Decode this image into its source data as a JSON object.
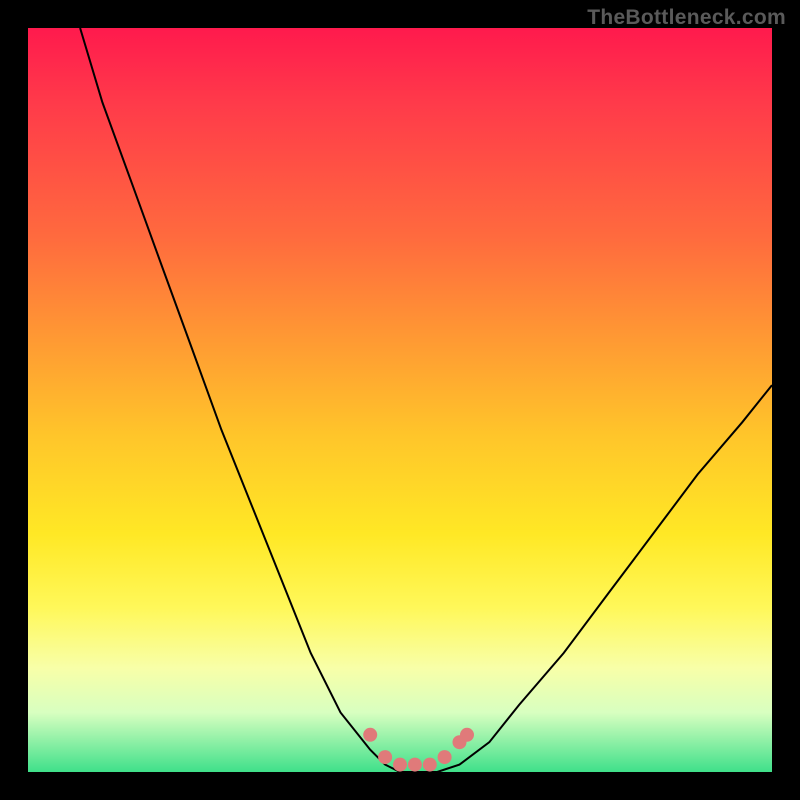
{
  "watermark": "TheBottleneck.com",
  "chart_data": {
    "type": "line",
    "title": "",
    "xlabel": "",
    "ylabel": "",
    "xlim": [
      0,
      100
    ],
    "ylim": [
      0,
      100
    ],
    "series": [
      {
        "name": "bottleneck-curve",
        "x": [
          7,
          10,
          14,
          18,
          22,
          26,
          30,
          34,
          38,
          42,
          46,
          48,
          50,
          53,
          55,
          58,
          62,
          66,
          72,
          78,
          84,
          90,
          96,
          100
        ],
        "y": [
          100,
          90,
          79,
          68,
          57,
          46,
          36,
          26,
          16,
          8,
          3,
          1,
          0,
          0,
          0,
          1,
          4,
          9,
          16,
          24,
          32,
          40,
          47,
          52
        ]
      }
    ],
    "markers": {
      "name": "highlight-points",
      "color": "#e07a7a",
      "x": [
        46,
        48,
        50,
        52,
        54,
        56,
        58,
        59
      ],
      "y": [
        5,
        2,
        1,
        1,
        1,
        2,
        4,
        5
      ]
    },
    "gradient_stops": [
      {
        "pos": 0,
        "color": "#ff1a4d"
      },
      {
        "pos": 28,
        "color": "#ff6a3e"
      },
      {
        "pos": 55,
        "color": "#ffc62a"
      },
      {
        "pos": 78,
        "color": "#fff85a"
      },
      {
        "pos": 100,
        "color": "#3fe08a"
      }
    ]
  }
}
